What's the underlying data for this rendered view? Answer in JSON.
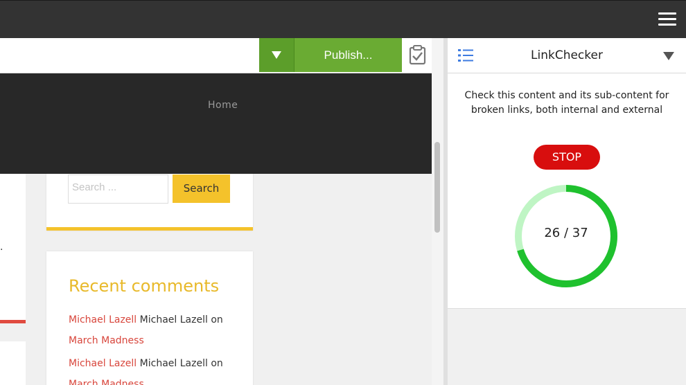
{
  "topbar": {
    "menu_icon": "hamburger-icon"
  },
  "toolbar": {
    "dropdown_icon": "caret-down-icon",
    "publish_label": "Publish...",
    "clipboard_icon": "clipboard-check-icon",
    "accent": "#6aab33"
  },
  "site": {
    "nav_home": "Home",
    "search": {
      "placeholder": "Search ...",
      "button_label": "Search"
    },
    "left_fragment": ".",
    "recent_comments": {
      "title": "Recent comments",
      "items": [
        {
          "author_link": "Michael Lazell",
          "author_text": "Michael Lazell",
          "on_text": "on",
          "post_link": "March Madness"
        },
        {
          "author_link": "Michael Lazell",
          "author_text": "Michael Lazell",
          "on_text": "on",
          "post_link": "March Madness"
        }
      ]
    }
  },
  "panel": {
    "title": "LinkChecker",
    "list_icon": "list-icon",
    "description": "Check this content and its sub-content for broken links, both internal and external",
    "stop_label": "STOP",
    "progress": {
      "checked": 26,
      "total": 37,
      "label": "26 / 37"
    },
    "colors": {
      "progress": "#1fc12e",
      "progress_track": "#bff5c4",
      "stop": "#d80e0e"
    }
  }
}
